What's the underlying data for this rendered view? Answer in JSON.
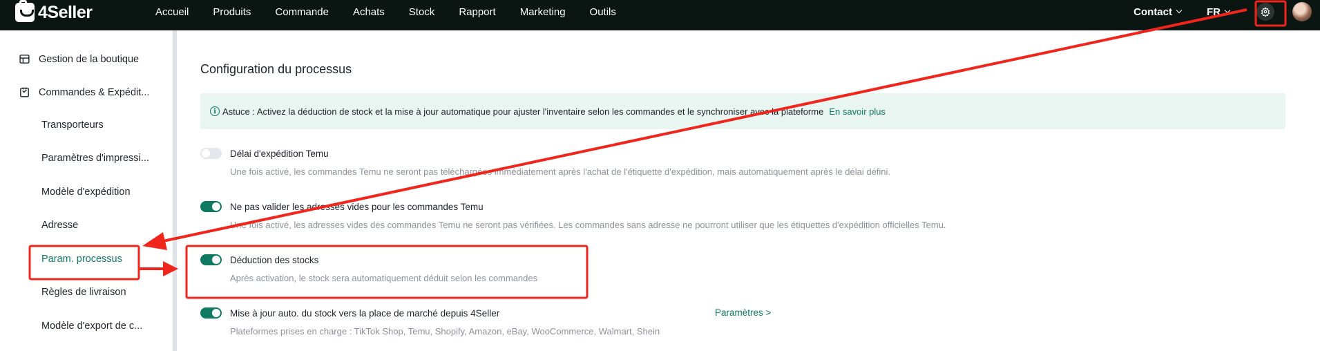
{
  "app": {
    "logo_text": "4Seller"
  },
  "nav": {
    "items": [
      "Accueil",
      "Produits",
      "Commande",
      "Achats",
      "Stock",
      "Rapport",
      "Marketing",
      "Outils"
    ]
  },
  "topbar": {
    "contact_label": "Contact",
    "language_label": "FR"
  },
  "sidebar": {
    "groups": [
      {
        "label": "Gestion de la boutique"
      },
      {
        "label": "Commandes & Expédit..."
      }
    ],
    "items": [
      {
        "label": "Transporteurs"
      },
      {
        "label": "Paramètres d'impressi..."
      },
      {
        "label": "Modèle d'expédition"
      },
      {
        "label": "Adresse"
      },
      {
        "label": "Param. processus"
      },
      {
        "label": "Règles de livraison"
      },
      {
        "label": "Modèle d'export de c..."
      }
    ]
  },
  "main": {
    "title": "Configuration du processus",
    "tip": {
      "text": "Astuce : Activez la déduction de stock et la mise à jour automatique pour ajuster l'inventaire selon les commandes et le synchroniser avec la plateforme",
      "link": "En savoir plus"
    },
    "settings": [
      {
        "label": "Délai d'expédition Temu",
        "enabled": false,
        "description": "Une fois activé, les commandes Temu ne seront pas téléchargées immédiatement après l'achat de l'étiquette d'expédition, mais automatiquement après le délai défini."
      },
      {
        "label": "Ne pas valider les adresses vides pour les commandes Temu",
        "enabled": true,
        "description": "Une fois activé, les adresses vides des commandes Temu ne seront pas vérifiées. Les commandes sans adresse ne pourront utiliser que les étiquettes d'expédition officielles Temu."
      },
      {
        "label": "Déduction des stocks",
        "enabled": true,
        "description": "Après activation, le stock sera automatiquement déduit selon les commandes"
      },
      {
        "label": "Mise à jour auto. du stock vers la place de marché depuis 4Seller",
        "enabled": true,
        "description": "Plateformes prises en charge : TikTok Shop, Temu, Shopify, Amazon, eBay, WooCommerce, Walmart, Shein",
        "link": "Paramètres >"
      }
    ]
  },
  "colors": {
    "accent": "#0e7a62",
    "topbar": "#0b1512",
    "annotation": "#f0261c"
  }
}
